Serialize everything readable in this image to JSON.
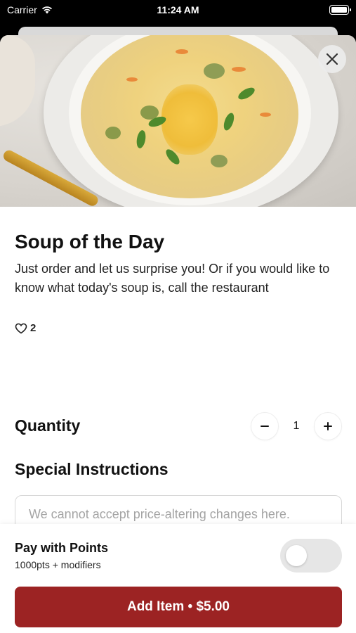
{
  "status_bar": {
    "carrier": "Carrier",
    "time": "11:24 AM",
    "wifi_icon": "wifi-icon",
    "battery_icon": "battery-icon"
  },
  "item": {
    "image": "soup-photo",
    "title": "Soup of the Day",
    "description": "Just order and let us surprise you! Or if you would like to know what today's soup is, call the restaurant",
    "likes_count": "2",
    "likes_icon": "heart-icon"
  },
  "close_icon": "close-icon",
  "quantity": {
    "label": "Quantity",
    "value": "1",
    "decrement_icon": "minus-icon",
    "increment_icon": "plus-icon"
  },
  "special_instructions": {
    "label": "Special Instructions",
    "placeholder": "We cannot accept price-altering changes here.",
    "value": ""
  },
  "points": {
    "title": "Pay with Points",
    "subtitle": "1000pts + modifiers",
    "enabled": false
  },
  "add_button": {
    "label": "Add Item • $5.00"
  },
  "colors": {
    "accent": "#9c2323",
    "toggle_off": "#e6e6e6"
  }
}
